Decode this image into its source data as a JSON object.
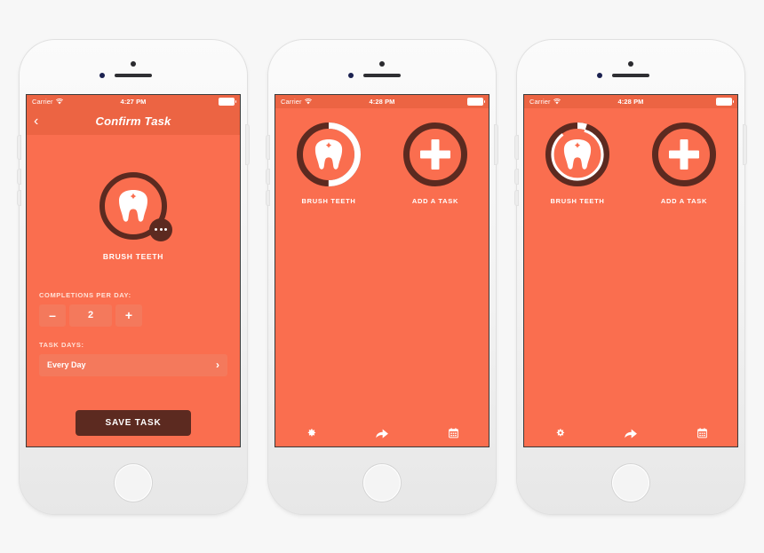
{
  "theme": {
    "page_background": "#f7f7f7",
    "app_orange": "#fa6e4f",
    "bar_orange": "#ec6443",
    "tint_orange": "#f4795c",
    "dark_brown": "#5c2a20",
    "white": "#ffffff"
  },
  "phones": [
    {
      "id": "phone-confirm-task",
      "status_bar": {
        "carrier": "Carrier",
        "wifi_icon": "wifi-icon",
        "time": "4:27 PM",
        "battery_icon": "battery-full-icon"
      },
      "nav": {
        "back_icon": "chevron-left-icon",
        "title": "Confirm Task"
      },
      "hero": {
        "icon": "tooth-icon",
        "badge_icon": "ellipsis-icon",
        "label": "BRUSH TEETH",
        "ring_progress_percent": 0
      },
      "form": {
        "completions_label": "COMPLETIONS PER DAY:",
        "decrement_label": "–",
        "value": "2",
        "increment_label": "+",
        "task_days_label": "TASK DAYS:",
        "task_days_value": "Every Day",
        "task_days_chevron": "chevron-right-icon"
      },
      "save_button": "SAVE TASK"
    },
    {
      "id": "phone-task-list-half",
      "status_bar": {
        "carrier": "Carrier",
        "wifi_icon": "wifi-icon",
        "time": "4:28 PM",
        "battery_icon": "battery-full-icon"
      },
      "tiles": [
        {
          "icon": "tooth-icon",
          "label": "BRUSH TEETH",
          "ring_progress_percent": 50,
          "arc_style": "thick"
        },
        {
          "icon": "plus-icon",
          "label": "ADD A TASK",
          "ring_progress_percent": 0,
          "arc_style": "none"
        }
      ],
      "tabbar": [
        {
          "icon": "gear-icon",
          "name": "settings"
        },
        {
          "icon": "share-arrow-icon",
          "name": "share"
        },
        {
          "icon": "calendar-icon",
          "name": "calendar"
        }
      ]
    },
    {
      "id": "phone-task-list-animating",
      "status_bar": {
        "carrier": "Carrier",
        "wifi_icon": "wifi-icon",
        "time": "4:28 PM",
        "battery_icon": "battery-full-icon"
      },
      "tiles": [
        {
          "icon": "tooth-icon",
          "label": "BRUSH TEETH",
          "ring_progress_percent": 50,
          "arc_style": "thin-inset"
        },
        {
          "icon": "plus-icon",
          "label": "ADD A TASK",
          "ring_progress_percent": 0,
          "arc_style": "none"
        }
      ],
      "tabbar": [
        {
          "icon": "gear-icon",
          "name": "settings"
        },
        {
          "icon": "share-arrow-icon",
          "name": "share"
        },
        {
          "icon": "calendar-icon",
          "name": "calendar"
        }
      ]
    }
  ]
}
